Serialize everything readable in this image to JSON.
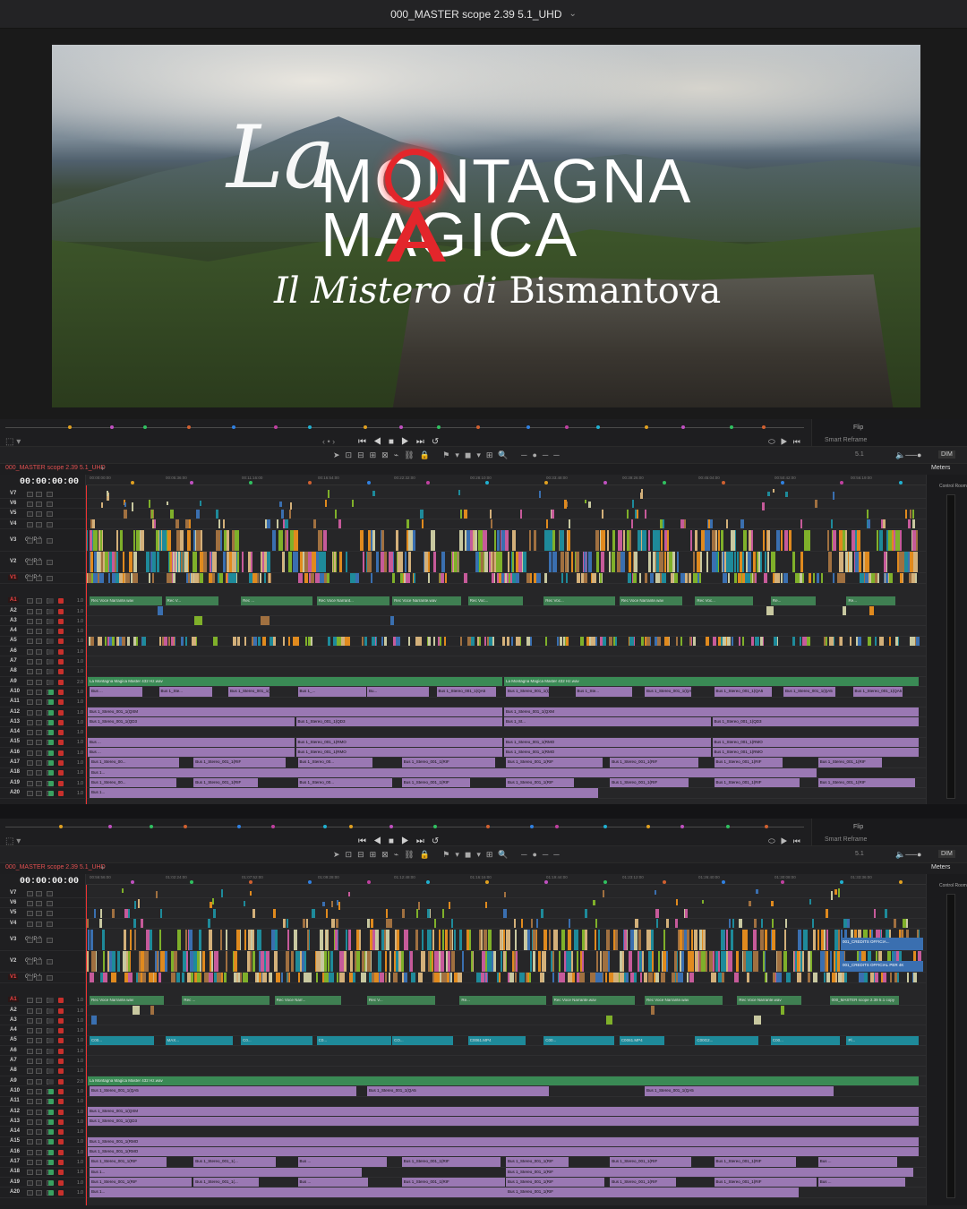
{
  "window": {
    "title": "000_MASTER scope 2.39 5.1_UHD"
  },
  "viewer": {
    "title_la": "La",
    "title_line1": "MONTAGNA",
    "title_line2": "MAGICA",
    "subtitle_italic": "Il Mistero di",
    "subtitle_regular": "Bismantova"
  },
  "controls": {
    "flip_label": "Flip",
    "smart_reframe": "Smart Reframe",
    "dim": "DIM",
    "channels": "5.1",
    "meters": "Meters",
    "control_room": "Control Room"
  },
  "timelines": [
    {
      "tab": "000_MASTER scope 2.39 5.1_UHD",
      "timecode": "00:00:00:00",
      "ruler": [
        "00:00:00:00",
        "00:05:36:00",
        "00:11:16:00",
        "00:16:54:00",
        "00:22:32:00",
        "00:28:10:00",
        "00:33:48:00",
        "00:39:26:00",
        "00:45:04:00",
        "00:50:42:00",
        "00:56:19:00"
      ],
      "video_tracks": [
        "V7",
        "V6",
        "V5",
        "V4",
        "V3",
        "V2",
        "V1"
      ],
      "video_labels": {
        "V3": "CLIP 3",
        "V2": "CLIP 2",
        "V1": "CLIP 1"
      },
      "audio_tracks": [
        "A1",
        "A2",
        "A3",
        "A4",
        "A5",
        "A6",
        "A7",
        "A8",
        "A9",
        "A10",
        "A11",
        "A12",
        "A13",
        "A14",
        "A15",
        "A16",
        "A17",
        "A18",
        "A19",
        "A20"
      ],
      "audio_gain": [
        "1.0",
        "1.0",
        "1.0",
        "1.0",
        "1.0",
        "1.0",
        "1.0",
        "1.0",
        "2.0",
        "1.0",
        "1.0",
        "1.0",
        "1.0",
        "1.0",
        "1.0",
        "1.0",
        "1.0",
        "1.0",
        "1.0",
        "1.0"
      ],
      "clips": {
        "a1": [
          "Rec Voce Narrante.wav",
          "Rec V...",
          "Rec ...",
          "Rec Voce Narrant...",
          "Rec Voce Narrante.wav",
          "Rec Voc...",
          "Rec Voc...",
          "Rec Voce Narrante.wav",
          "Rec Voc...",
          "Re...",
          "Re..."
        ],
        "a9": [
          "La Montagna Magica Master 432 Hz.wav",
          "La Montagna Magica Master 432 Hz.wav"
        ],
        "a10": [
          "Bus ...",
          "Bus 1_Ste...",
          "Bus 1_Stereo_001_1(QA5",
          "Bus 1_...",
          "Bu...",
          "Bus 1_Stereo_001_1(QA5",
          "Bus 1_Stereo_001_1(QA5",
          "Bus 1_Ste...",
          "Bus 1_Stereo_001_1(QA5",
          "Bus 1_Stereo_001_1(QA5",
          "Bus 1_Stereo_001_1(QA5",
          "Bus 1_Stereo_001_1(QA5"
        ],
        "a12": [
          "Bus 1_Stereo_001_1(QXM",
          "Bus 1_Stereo_001_1(QXM"
        ],
        "a13": [
          "Bus 1_Stereo_001_1(QD3",
          "Bus 1_Stereo_001_1(QD3",
          "Bus 1_St...",
          "Bus 1_Stereo_001_1(QD3"
        ],
        "a15": [
          "Bus ...",
          "Bus 1_Stereo_001_1(RMO",
          "Bus 1_Stereo_001_1(RMO",
          "Bus 1_Stereo_001_1(RMO"
        ],
        "a17": [
          "Bus 1_Stereo_00...",
          "Bus 1_Stereo_001_1(RIF",
          "Bus 1_Stereo_00...",
          "Bus 1_Stereo_001_1(RIF",
          "Bus 1_Stereo_001_1(RIF",
          "Bus 1_Stereo_001_1(RIF",
          "Bus 1_Stereo_001_1(RIF",
          "Bus 1_Stereo_001_1(RIF"
        ]
      }
    },
    {
      "tab": "000_MASTER scope 2.39 5.1_UHD",
      "timecode": "00:00:00:00",
      "ruler": [
        "00:56:56:00",
        "01:02:24:00",
        "01:07:52:00",
        "01:09:28:00",
        "01:12:48:00",
        "01:16:16:00",
        "01:19:44:00",
        "01:23:12:00",
        "01:26:40:00",
        "01:30:08:00",
        "01:33:36:00"
      ],
      "video_tracks": [
        "V7",
        "V6",
        "V5",
        "V4",
        "V3",
        "V2",
        "V1"
      ],
      "video_labels": {
        "V3": "CLIP 3",
        "V2": "CLIP 2",
        "V1": "CLIP 1"
      },
      "audio_tracks": [
        "A1",
        "A2",
        "A3",
        "A4",
        "A5",
        "A6",
        "A7",
        "A8",
        "A9",
        "A10",
        "A11",
        "A12",
        "A13",
        "A14",
        "A15",
        "A16",
        "A17",
        "A18",
        "A19",
        "A20"
      ],
      "audio_gain": [
        "1.0",
        "1.0",
        "1.0",
        "1.0",
        "1.0",
        "1.0",
        "1.0",
        "1.0",
        "2.0",
        "1.0",
        "1.0",
        "1.0",
        "1.0",
        "1.0",
        "1.0",
        "1.0",
        "1.0",
        "1.0",
        "1.0",
        "1.0"
      ],
      "clips": {
        "v3": [
          "001_CREDITS OFFICIA..."
        ],
        "v2": [
          "001_CREDITS OFFICIAL PER 4K"
        ],
        "v1": [
          "C00...",
          "MAX...",
          "C0061.MP4",
          "C0061.MP4",
          "C00..."
        ],
        "a1": [
          "Rec Voce Narrante.wav",
          "Rec ...",
          "Rec Voce Narr...",
          "Rec V...",
          "Re...",
          "Rec Voce Narrante.wav",
          "Rec Voce Narrante.wav",
          "Rec Voce Narrante.wav",
          "000_MASTER scope 2.39 5.1 copy"
        ],
        "a5": [
          "C00...",
          "MAX...",
          "C0...",
          "C0...",
          "CO...",
          "C0061.MP4",
          "C00...",
          "C0061.MP4",
          "C00G2...",
          "C00...",
          "Pl..."
        ],
        "a9": [
          "La Montagna Magica Master 432 Hz.wav"
        ],
        "a10": [
          "Bus 1_Stereo_001_1(QA5",
          "Bus 1_Stereo_001_1(QA5",
          "Bus 1_Stereo_001_1(QA5"
        ],
        "a12": [
          "Bus 1_Stereo_001_1(QXM"
        ],
        "a13": [
          "Bus 1_Stereo_001_1(QD3"
        ],
        "a15": [
          "Bus 1_Stereo_001_1(RMO"
        ],
        "a16": [
          "Bus 1_Stereo_001_1(RMO"
        ],
        "a17": [
          "Bus 1_Stereo_001_1(RIF",
          "Bus 1_Stereo_001_1(...",
          "Bus ...",
          "Bus 1_Stereo_001_1(RIF",
          "Bus 1_Stereo_001_1(RIF",
          "Bus 1_Stereo_001_1(RIF",
          "Bus 1_Stereo_001_1(RIF",
          "Bus ..."
        ],
        "a18": [
          "Bus 1...",
          "Bus 1_Stereo_001_1(RIF"
        ]
      }
    }
  ],
  "colors": {
    "voice": "#3f7f52",
    "music": "#3a8a55",
    "bus": "#9a78b3",
    "accent_red": "#e3262b",
    "video_orange": "#e08a1e",
    "video_teal": "#1e8a9a",
    "video_pink": "#c65a9a",
    "video_lime": "#7fb02a"
  }
}
